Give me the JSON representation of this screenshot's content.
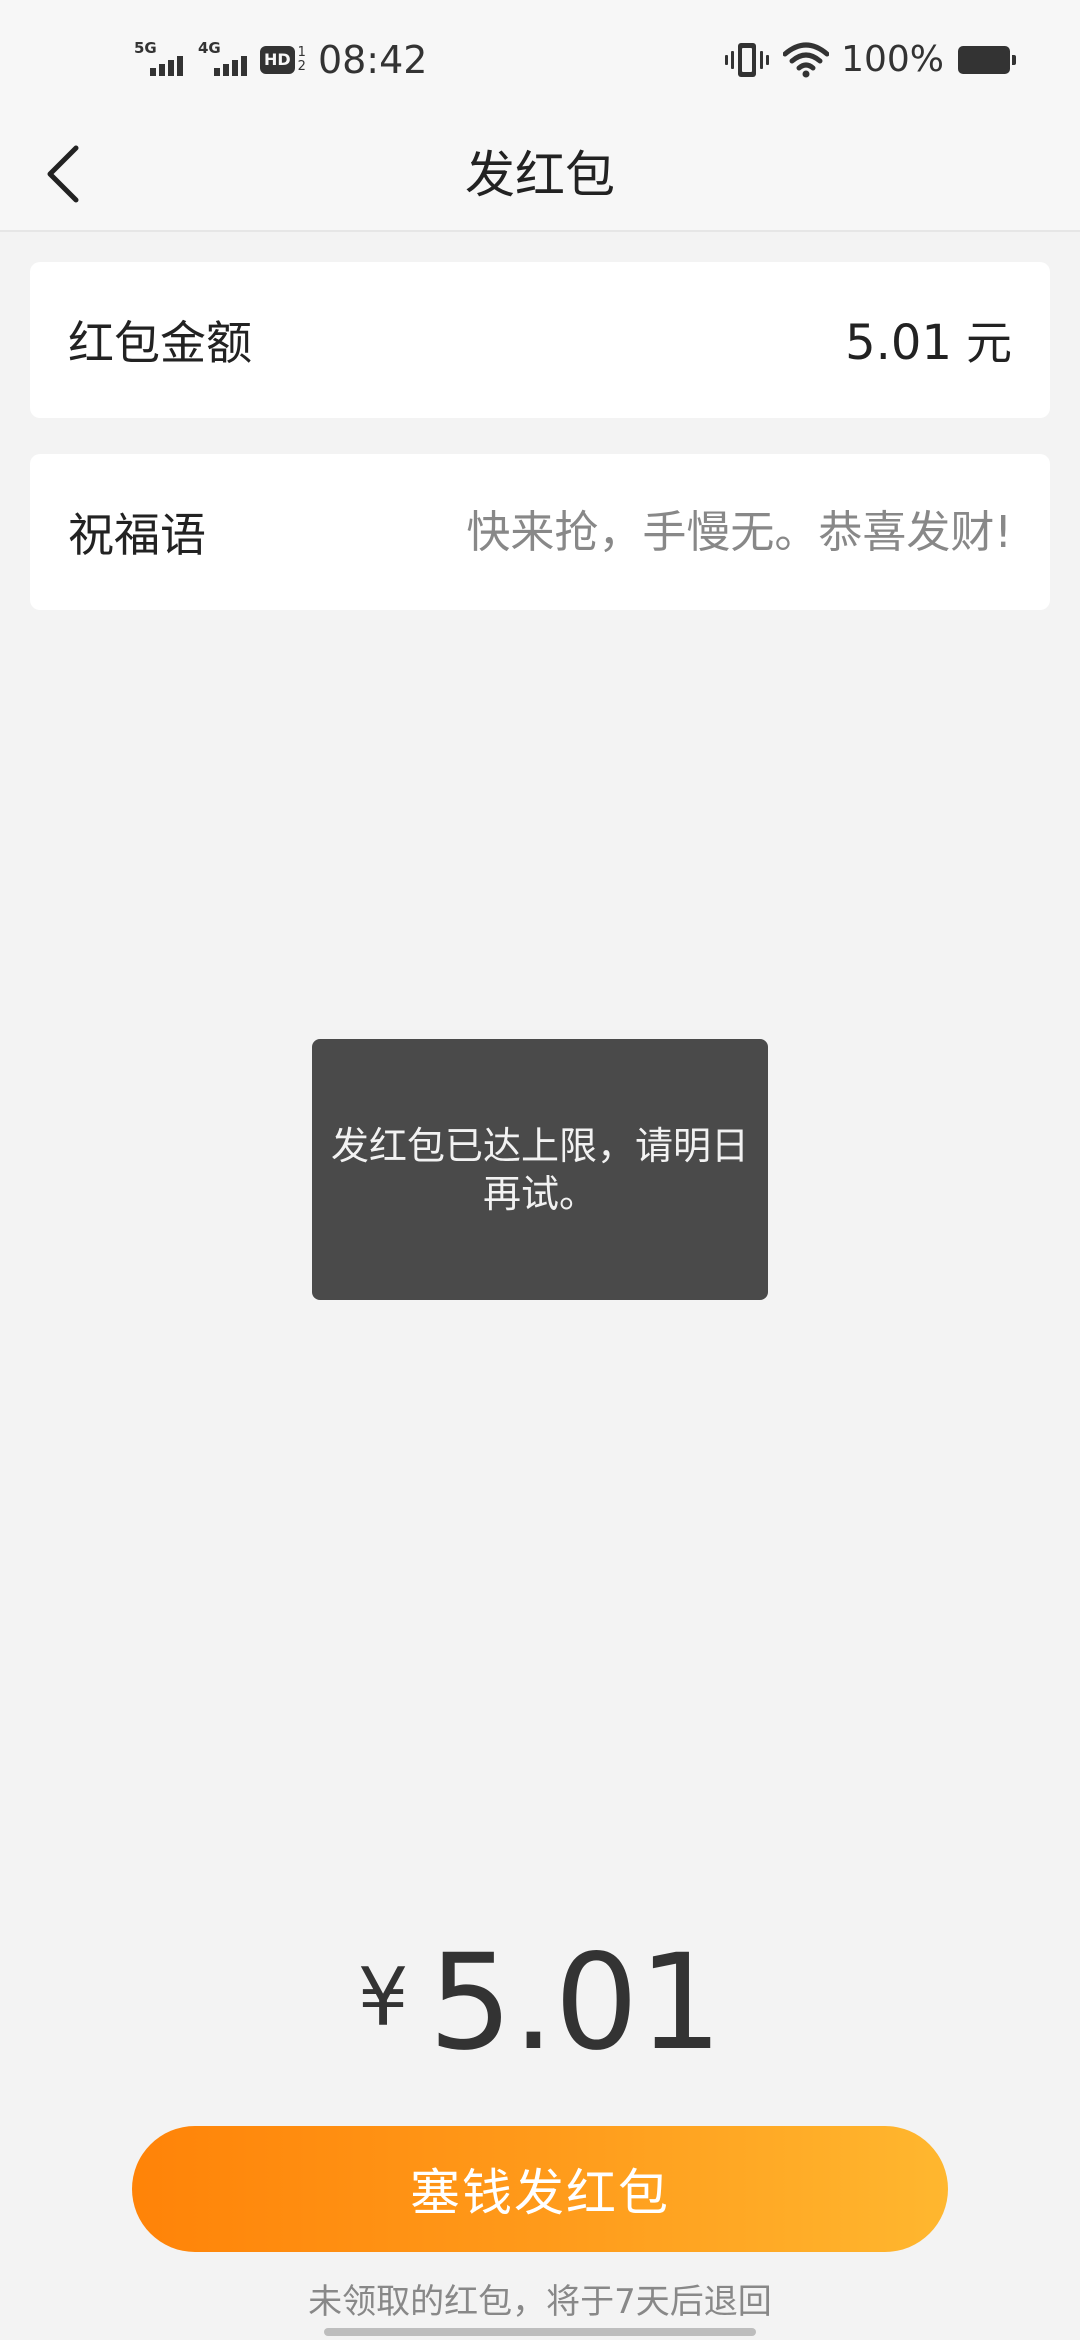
{
  "status_bar": {
    "sim1_network": "5G",
    "sim2_network": "4G",
    "hd_label": "HD",
    "hd_sim_top": "1",
    "hd_sim_bottom": "2",
    "time": "08:42",
    "battery_percent": "100%",
    "icons": [
      "signal-5g-icon",
      "signal-4g-icon",
      "hd-voice-icon",
      "vibrate-icon",
      "wifi-icon",
      "battery-icon"
    ]
  },
  "header": {
    "back_icon": "chevron-left-icon",
    "title": "发红包"
  },
  "form": {
    "amount_label": "红包金额",
    "amount_value": "5.01",
    "amount_unit": "元",
    "greeting_label": "祝福语",
    "greeting_placeholder": "快来抢，手慢无。恭喜发财!"
  },
  "toast": {
    "message": "发红包已达上限，请明日再试。"
  },
  "total": {
    "currency_symbol": "¥",
    "amount": "5.01"
  },
  "send_button": {
    "label": "塞钱发红包"
  },
  "footer_note": "未领取的红包，将于7天后退回",
  "colors": {
    "accent_start": "#ff8308",
    "accent_end": "#ffb72f",
    "background": "#f3f3f3",
    "toast_background": "#4a4a4a"
  }
}
